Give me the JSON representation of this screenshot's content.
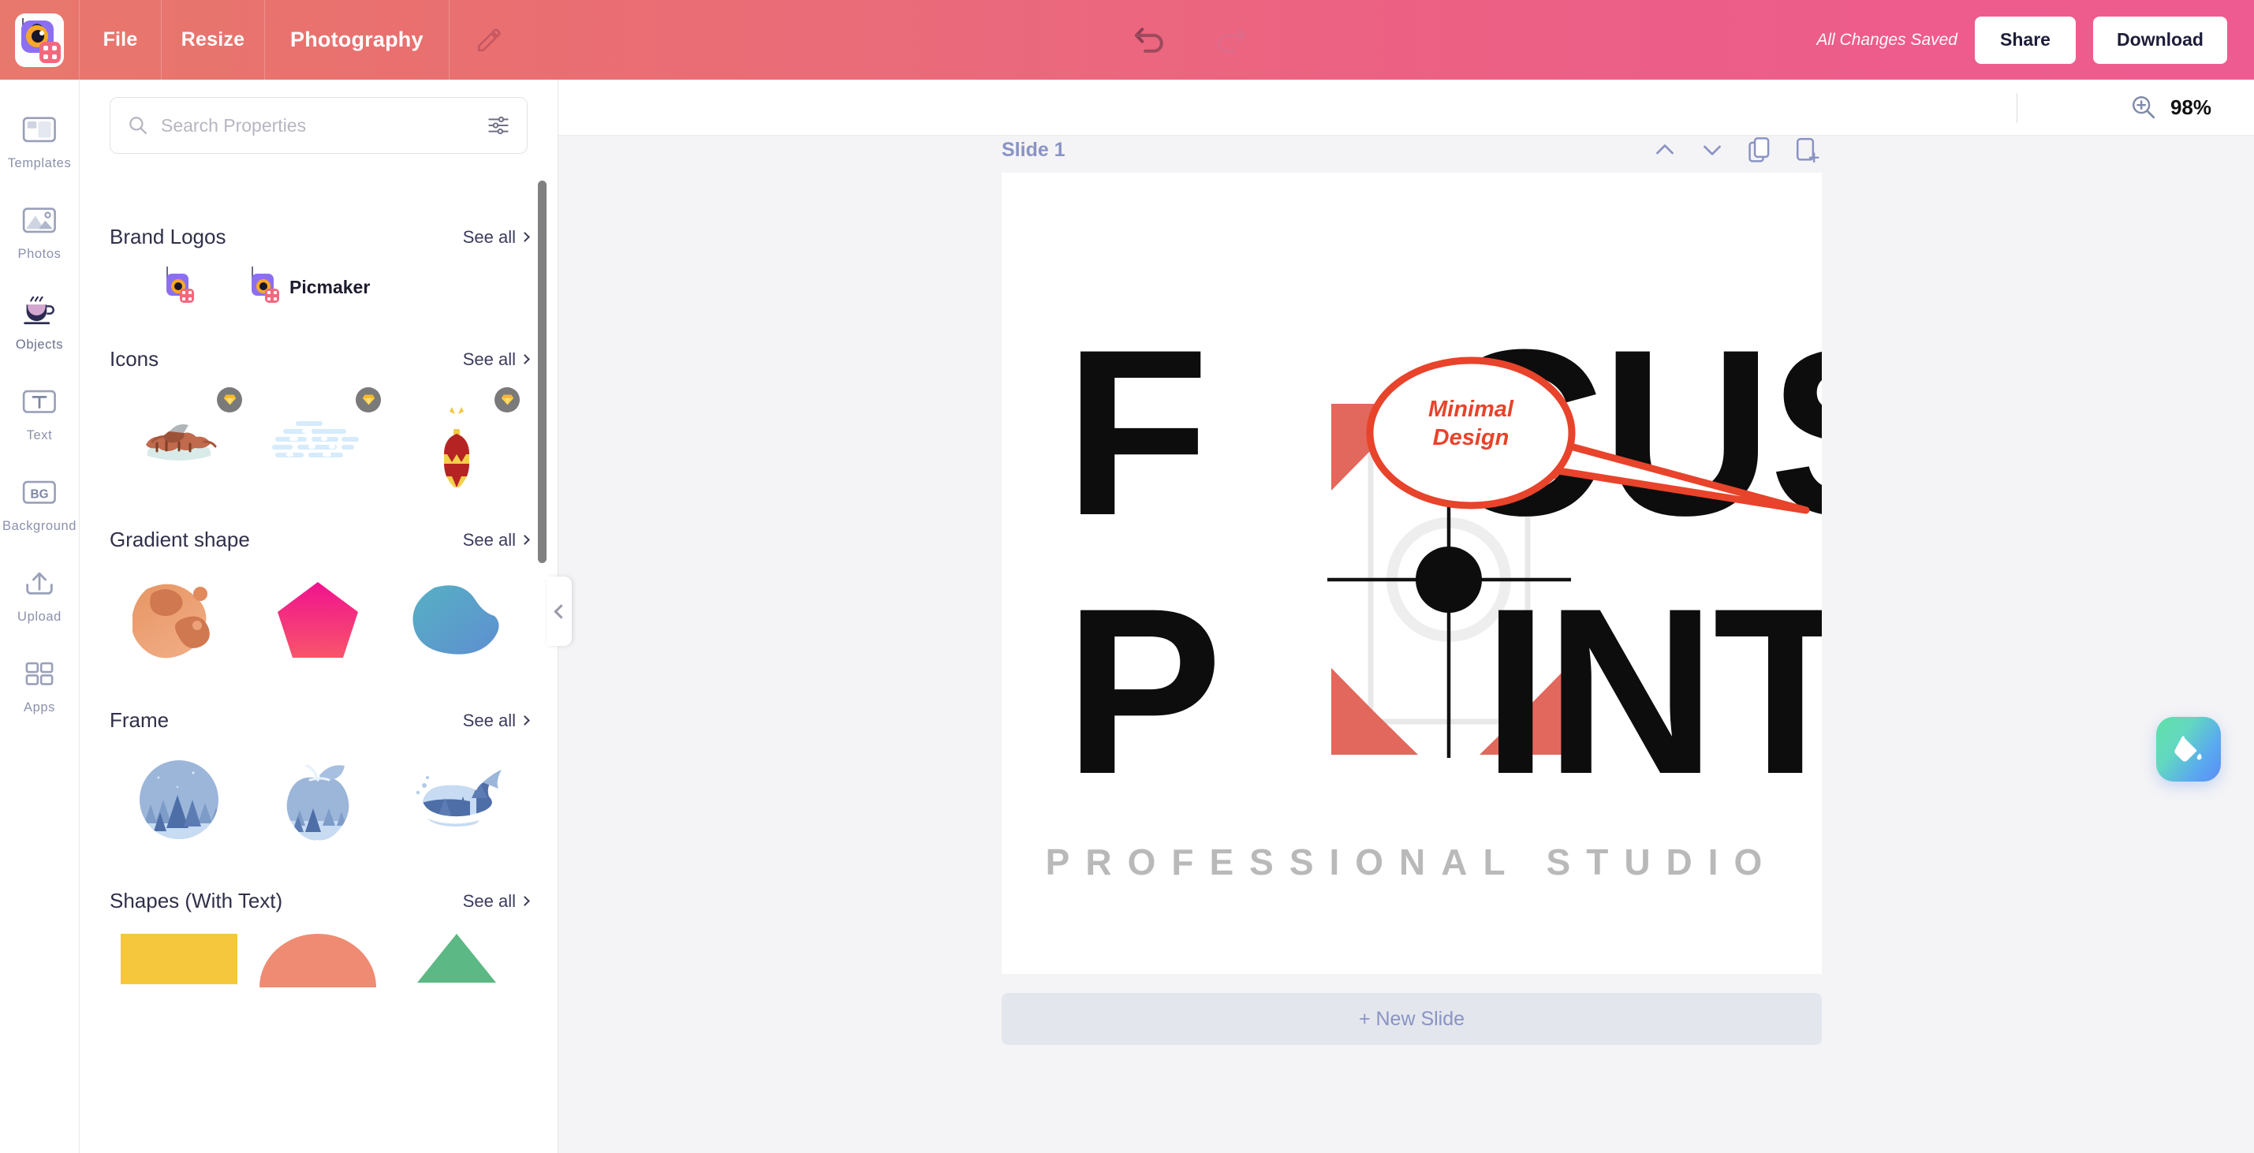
{
  "header": {
    "app_logo": "picmaker-logo-icon",
    "menu": [
      {
        "label": "File",
        "name": "file"
      },
      {
        "label": "Resize",
        "name": "resize"
      }
    ],
    "project_title": "Photography",
    "edit_icon": "pencil-icon",
    "undo_icon": "undo-arrow-icon",
    "redo_icon": "redo-arrow-icon",
    "save_status": "All Changes Saved",
    "share_label": "Share",
    "download_label": "Download",
    "gradient_start": "#e8786e",
    "gradient_end": "#ee5b90"
  },
  "rail": {
    "items": [
      {
        "label": "Templates",
        "icon": "templates-icon",
        "active": false
      },
      {
        "label": "Photos",
        "icon": "photos-icon",
        "active": false
      },
      {
        "label": "Objects",
        "icon": "objects-coffee-cup-icon",
        "active": true
      },
      {
        "label": "Text",
        "icon": "text-icon",
        "active": false
      },
      {
        "label": "Background",
        "icon": "background-bg-icon",
        "active": false
      },
      {
        "label": "Upload",
        "icon": "upload-icon",
        "active": false
      },
      {
        "label": "Apps",
        "icon": "apps-grid-icon",
        "active": false
      }
    ]
  },
  "panel": {
    "search": {
      "placeholder": "Search Properties",
      "value": "",
      "search_icon": "search-icon",
      "filter_icon": "sliders-filter-icon"
    },
    "see_all_label": "See all",
    "sections": [
      {
        "title": "Brand Logos",
        "name": "brand-logos",
        "items": [
          {
            "name": "picmaker-mark",
            "label": ""
          },
          {
            "name": "picmaker-wordmark",
            "label": "Picmaker"
          }
        ]
      },
      {
        "title": "Icons",
        "name": "icons",
        "items": [
          {
            "name": "grilled-sausages-icon",
            "premium": true
          },
          {
            "name": "snow-clouds-icon",
            "premium": true
          },
          {
            "name": "christmas-ornament-icon",
            "premium": true
          }
        ]
      },
      {
        "title": "Gradient shape",
        "name": "gradient-shape",
        "items": [
          {
            "name": "orange-blob-shape",
            "color": "#e28a5e"
          },
          {
            "name": "pink-pentagon-shape",
            "color": "#f0218f"
          },
          {
            "name": "teal-blob-shape",
            "color": "#55a8c4"
          }
        ]
      },
      {
        "title": "Frame",
        "name": "frame",
        "items": [
          {
            "name": "circle-forest-frame"
          },
          {
            "name": "apple-forest-frame"
          },
          {
            "name": "whale-forest-frame"
          }
        ]
      },
      {
        "title": "Shapes (With Text)",
        "name": "shapes-with-text",
        "items": [
          {
            "name": "yellow-rectangle-shape",
            "color": "#f5c73c"
          },
          {
            "name": "salmon-semicircle-shape",
            "color": "#ef8b72"
          },
          {
            "name": "green-triangle-shape",
            "color": "#5cb884"
          }
        ]
      }
    ],
    "collapse_icon": "chevron-left-icon"
  },
  "canvas": {
    "zoom": {
      "icon": "zoom-in-magnifier-icon",
      "level": "98%"
    },
    "slide_label": "Slide 1",
    "slide_tools": [
      {
        "name": "move-slide-up",
        "icon": "chevron-up-icon"
      },
      {
        "name": "move-slide-down",
        "icon": "chevron-down-icon"
      },
      {
        "name": "duplicate-slide",
        "icon": "copy-icon"
      },
      {
        "name": "add-slide",
        "icon": "add-page-icon"
      }
    ],
    "new_slide_label": "+ New Slide",
    "fab": {
      "name": "fill-color-button",
      "icon": "paint-bucket-icon"
    }
  },
  "design": {
    "logo": {
      "line1_left": "F",
      "line1_right": "CUS",
      "line2_left": "P",
      "line2_right": "INT",
      "tagline": "PROFESSIONAL STUDIO",
      "text_color": "#0d0d0d",
      "accent_color": "#e2675c",
      "tagline_color": "#b9b9b9"
    },
    "callout": {
      "text_line1": "Minimal",
      "text_line2": "Design",
      "color": "#e8432b"
    }
  }
}
